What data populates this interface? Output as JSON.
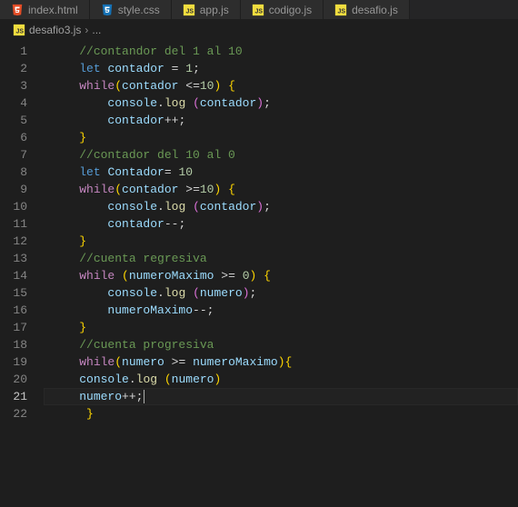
{
  "tabs": [
    {
      "icon": "html",
      "label": "index.html"
    },
    {
      "icon": "css",
      "label": "style.css"
    },
    {
      "icon": "js",
      "label": "app.js"
    },
    {
      "icon": "js",
      "label": "codigo.js"
    },
    {
      "icon": "js",
      "label": "desafio.js"
    }
  ],
  "breadcrumb": {
    "icon": "js",
    "file": "desafio3.js",
    "sep": "›",
    "symbol": "..."
  },
  "active_line": 21,
  "lines": [
    {
      "n": 1,
      "tokens": [
        [
          "    ",
          "ind"
        ],
        [
          "//contandor del 1 al 10",
          "comment"
        ]
      ]
    },
    {
      "n": 2,
      "tokens": [
        [
          "    ",
          "ind"
        ],
        [
          "let",
          "keyword"
        ],
        [
          " ",
          "op"
        ],
        [
          "contador",
          "var"
        ],
        [
          " = ",
          "op"
        ],
        [
          "1",
          "num"
        ],
        [
          ";",
          "op"
        ]
      ]
    },
    {
      "n": 3,
      "tokens": [
        [
          "    ",
          "ind"
        ],
        [
          "while",
          "keyword2"
        ],
        [
          "(",
          "brace"
        ],
        [
          "contador",
          "var"
        ],
        [
          " <=",
          "op"
        ],
        [
          "10",
          "num"
        ],
        [
          ")",
          "brace"
        ],
        [
          " ",
          "op"
        ],
        [
          "{",
          "brace"
        ]
      ]
    },
    {
      "n": 4,
      "tokens": [
        [
          "        ",
          "ind"
        ],
        [
          "console",
          "obj"
        ],
        [
          ".",
          "op"
        ],
        [
          "log",
          "func"
        ],
        [
          " ",
          "op"
        ],
        [
          "(",
          "brace2"
        ],
        [
          "contador",
          "var"
        ],
        [
          ")",
          "brace2"
        ],
        [
          ";",
          "op"
        ]
      ]
    },
    {
      "n": 5,
      "tokens": [
        [
          "        ",
          "ind"
        ],
        [
          "contador",
          "var"
        ],
        [
          "++;",
          "op"
        ]
      ]
    },
    {
      "n": 6,
      "tokens": [
        [
          "    ",
          "ind"
        ],
        [
          "}",
          "brace"
        ]
      ]
    },
    {
      "n": 7,
      "tokens": [
        [
          "    ",
          "ind"
        ],
        [
          "//contador del 10 al 0",
          "comment"
        ]
      ]
    },
    {
      "n": 8,
      "tokens": [
        [
          "    ",
          "ind"
        ],
        [
          "let",
          "keyword"
        ],
        [
          " ",
          "op"
        ],
        [
          "Contador",
          "var"
        ],
        [
          "= ",
          "op"
        ],
        [
          "10",
          "num"
        ]
      ]
    },
    {
      "n": 9,
      "tokens": [
        [
          "    ",
          "ind"
        ],
        [
          "while",
          "keyword2"
        ],
        [
          "(",
          "brace"
        ],
        [
          "contador",
          "var"
        ],
        [
          " >=",
          "op"
        ],
        [
          "10",
          "num"
        ],
        [
          ")",
          "brace"
        ],
        [
          " ",
          "op"
        ],
        [
          "{",
          "brace"
        ]
      ]
    },
    {
      "n": 10,
      "tokens": [
        [
          "        ",
          "ind"
        ],
        [
          "console",
          "obj"
        ],
        [
          ".",
          "op"
        ],
        [
          "log",
          "func"
        ],
        [
          " ",
          "op"
        ],
        [
          "(",
          "brace2"
        ],
        [
          "contador",
          "var"
        ],
        [
          ")",
          "brace2"
        ],
        [
          ";",
          "op"
        ]
      ]
    },
    {
      "n": 11,
      "tokens": [
        [
          "        ",
          "ind"
        ],
        [
          "contador",
          "var"
        ],
        [
          "--;",
          "op"
        ]
      ]
    },
    {
      "n": 12,
      "tokens": [
        [
          "    ",
          "ind"
        ],
        [
          "}",
          "brace"
        ]
      ]
    },
    {
      "n": 13,
      "tokens": [
        [
          "    ",
          "ind"
        ],
        [
          "//cuenta regresiva",
          "comment"
        ]
      ]
    },
    {
      "n": 14,
      "tokens": [
        [
          "    ",
          "ind"
        ],
        [
          "while",
          "keyword2"
        ],
        [
          " ",
          "op"
        ],
        [
          "(",
          "brace"
        ],
        [
          "numeroMaximo",
          "var"
        ],
        [
          " >= ",
          "op"
        ],
        [
          "0",
          "num"
        ],
        [
          ")",
          "brace"
        ],
        [
          " ",
          "op"
        ],
        [
          "{",
          "brace"
        ]
      ]
    },
    {
      "n": 15,
      "tokens": [
        [
          "        ",
          "ind"
        ],
        [
          "console",
          "obj"
        ],
        [
          ".",
          "op"
        ],
        [
          "log",
          "func"
        ],
        [
          " ",
          "op"
        ],
        [
          "(",
          "brace2"
        ],
        [
          "numero",
          "var"
        ],
        [
          ")",
          "brace2"
        ],
        [
          ";",
          "op"
        ]
      ]
    },
    {
      "n": 16,
      "tokens": [
        [
          "        ",
          "ind"
        ],
        [
          "numeroMaximo",
          "var"
        ],
        [
          "--;",
          "op"
        ]
      ]
    },
    {
      "n": 17,
      "tokens": [
        [
          "    ",
          "ind"
        ],
        [
          "}",
          "brace"
        ]
      ]
    },
    {
      "n": 18,
      "tokens": [
        [
          "    ",
          "ind"
        ],
        [
          "//cuenta progresiva",
          "comment"
        ]
      ]
    },
    {
      "n": 19,
      "tokens": [
        [
          "    ",
          "ind"
        ],
        [
          "while",
          "keyword2"
        ],
        [
          "(",
          "brace"
        ],
        [
          "numero",
          "var"
        ],
        [
          " >= ",
          "op"
        ],
        [
          "numeroMaximo",
          "var"
        ],
        [
          ")",
          "brace"
        ],
        [
          "{",
          "brace"
        ]
      ]
    },
    {
      "n": 20,
      "tokens": [
        [
          "    ",
          "ind"
        ],
        [
          "console",
          "obj"
        ],
        [
          ".",
          "op"
        ],
        [
          "log",
          "func"
        ],
        [
          " ",
          "op"
        ],
        [
          "(",
          "brace"
        ],
        [
          "numero",
          "var"
        ],
        [
          ")",
          "brace"
        ]
      ]
    },
    {
      "n": 21,
      "tokens": [
        [
          "    ",
          "ind"
        ],
        [
          "numero",
          "var"
        ],
        [
          "++;",
          "op"
        ]
      ]
    },
    {
      "n": 22,
      "tokens": [
        [
          "     ",
          "ind"
        ],
        [
          "}",
          "brace"
        ]
      ]
    }
  ]
}
